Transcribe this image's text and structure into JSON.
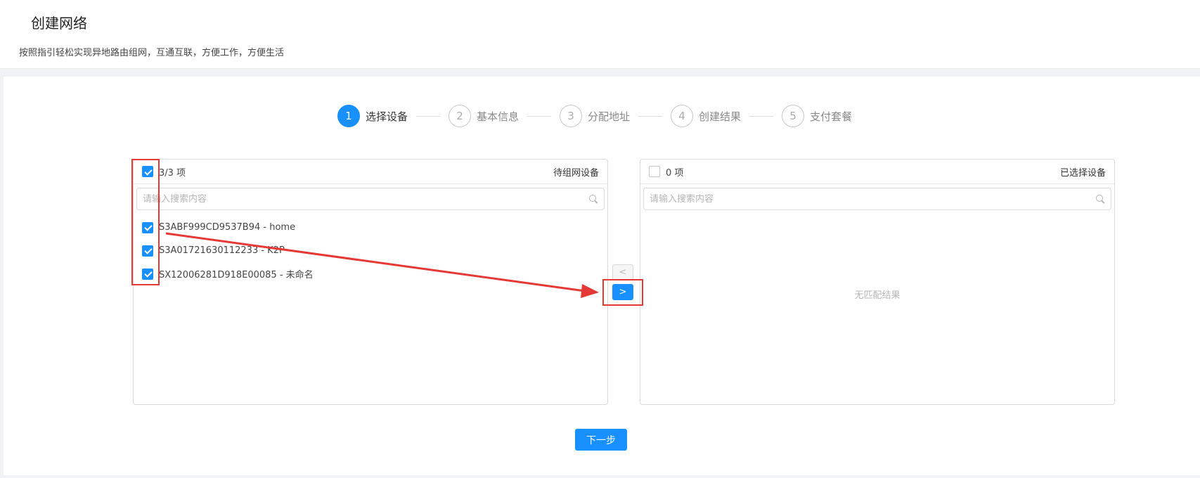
{
  "header": {
    "title": "创建网络",
    "subtitle": "按照指引轻松实现异地路由组网，互通互联，方便工作，方便生活"
  },
  "steps": [
    {
      "number": "1",
      "label": "选择设备",
      "active": true
    },
    {
      "number": "2",
      "label": "基本信息",
      "active": false
    },
    {
      "number": "3",
      "label": "分配地址",
      "active": false
    },
    {
      "number": "4",
      "label": "创建结果",
      "active": false
    },
    {
      "number": "5",
      "label": "支付套餐",
      "active": false
    }
  ],
  "left_panel": {
    "count": "3/3 项",
    "title": "待组网设备",
    "search_placeholder": "请输入搜索内容",
    "items": [
      {
        "label": "S3ABF999CD9537B94 - home",
        "checked": true
      },
      {
        "label": "S3A01721630112233 - K2P",
        "checked": true
      },
      {
        "label": "SX12006281D918E00085 - 未命名",
        "checked": true
      }
    ]
  },
  "right_panel": {
    "count": "0 项",
    "title": "已选择设备",
    "search_placeholder": "请输入搜索内容",
    "empty_text": "无匹配结果"
  },
  "transfer": {
    "move_left_label": "<",
    "move_right_label": ">"
  },
  "next_button": "下一步",
  "colors": {
    "primary": "#1890ff",
    "annotation": "#e53935"
  }
}
